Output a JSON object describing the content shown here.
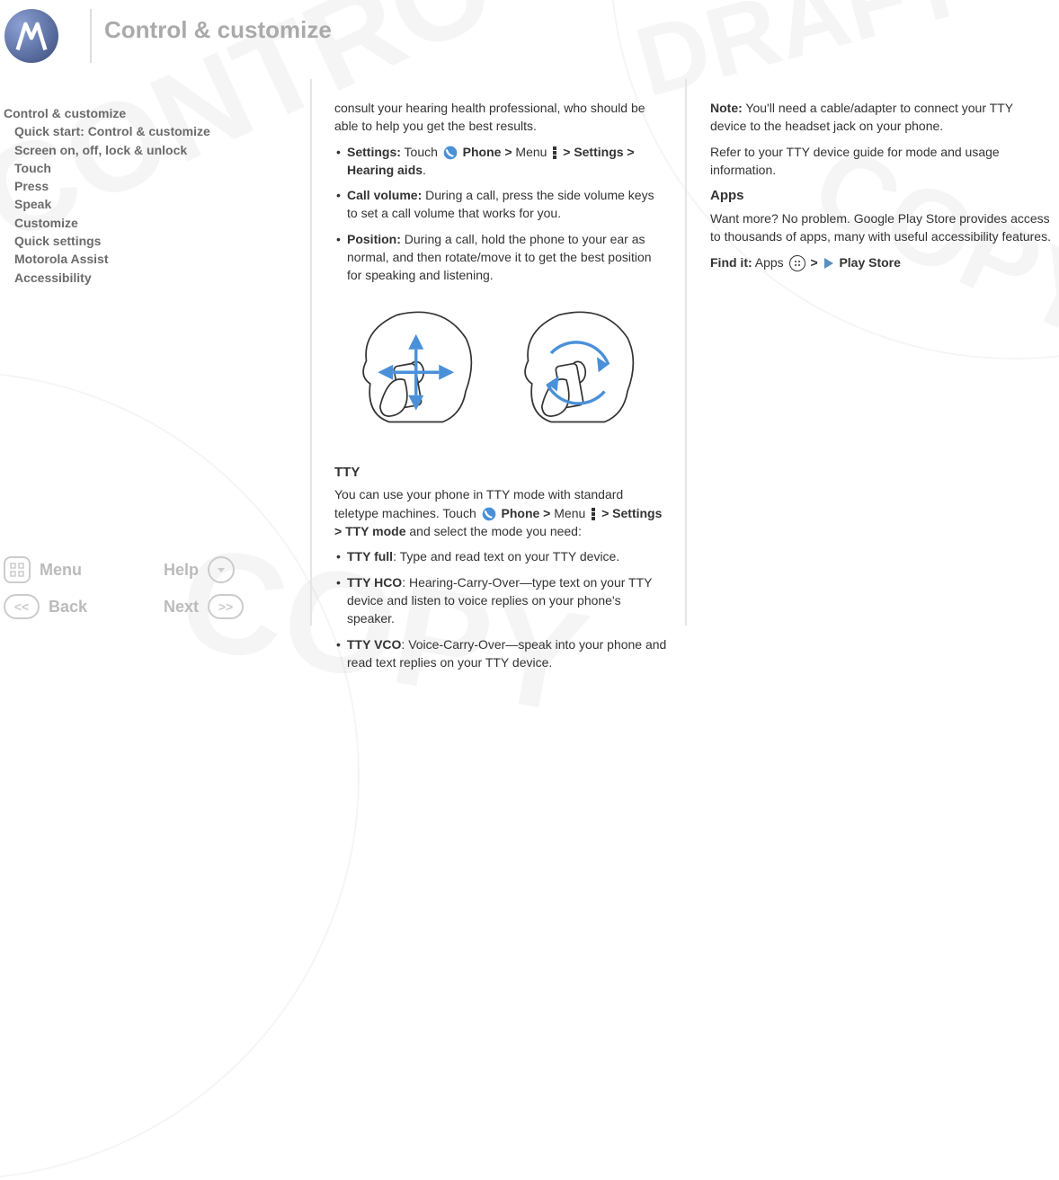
{
  "title": "Control & customize",
  "toc": {
    "heading": "Control & customize",
    "items": [
      "Quick start: Control & customize",
      "Screen on, off, lock & unlock",
      "Touch",
      "Press",
      "Speak",
      "Customize",
      "Quick settings",
      "Motorola Assist",
      "Accessibility"
    ]
  },
  "bottom_nav": {
    "menu": "Menu",
    "help": "Help",
    "back": "Back",
    "next": "Next"
  },
  "col1": {
    "intro": "consult your hearing health professional, who should be able to help you get the best results.",
    "settings_label": "Settings:",
    "settings_text1": " Touch ",
    "phone_label": "Phone",
    "arrow": " > ",
    "menu_word": "Menu ",
    "settings_word": "Settings",
    "hearing_aids": "Hearing aids",
    "period": ".",
    "callvol_label": "Call volume:",
    "callvol_text": " During a call, press the side volume keys to set a call volume that works for you.",
    "position_label": "Position:",
    "position_text": " During a call, hold the phone to your ear as normal, and then rotate/move it to get the best position for speaking and listening.",
    "tty_heading": "TTY",
    "tty_intro1": "You can use your phone in TTY mode with standard teletype machines. Touch ",
    "tty_mode": "TTY mode",
    "tty_intro2": " and select the mode you need:",
    "tty_full_label": "TTY full",
    "tty_full_text": ": Type and read text on your TTY device.",
    "tty_hco_label": "TTY HCO",
    "tty_hco_text": ": Hearing-Carry-Over—type text on your TTY device and listen to voice replies on your phone's speaker.",
    "tty_vco_label": "TTY VCO",
    "tty_vco_text": ": Voice-Carry-Over—speak into your phone and read text replies on your TTY device."
  },
  "col2": {
    "note_label": "Note:",
    "note_text": " You'll need a cable/adapter to connect your TTY device to the headset jack on your phone.",
    "refer_text": "Refer to your TTY device guide for mode and usage information.",
    "apps_heading": "Apps",
    "apps_text": "Want more? No problem. Google Play Store provides access to thousands of apps, many with useful accessibility features.",
    "findit_label": "Find it:",
    "apps_word": " Apps ",
    "play_store": "Play Store"
  }
}
